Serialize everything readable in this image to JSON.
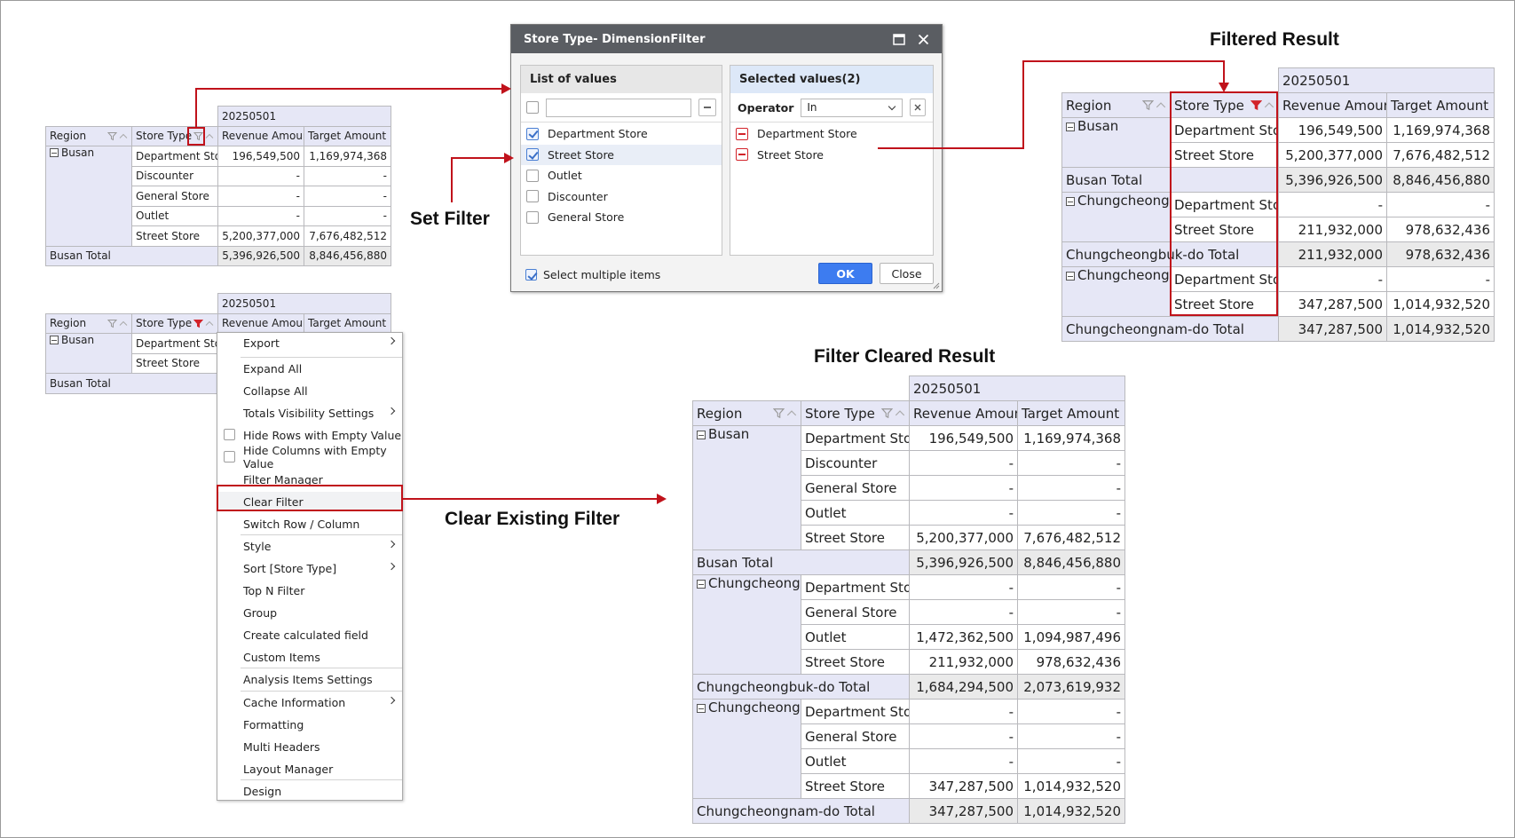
{
  "column_date": "20250501",
  "headers": {
    "region": "Region",
    "store_type": "Store Type",
    "revenue": "Revenue Amount",
    "target": "Target Amount"
  },
  "pivot_top": {
    "region": "Busan",
    "rows": [
      {
        "store": "Department Stor",
        "revenue": "196,549,500",
        "target": "1,169,974,368"
      },
      {
        "store": "Discounter",
        "revenue": "-",
        "target": "-"
      },
      {
        "store": "General Store",
        "revenue": "-",
        "target": "-"
      },
      {
        "store": "Outlet",
        "revenue": "-",
        "target": "-"
      },
      {
        "store": "Street Store",
        "revenue": "5,200,377,000",
        "target": "7,676,482,512"
      }
    ],
    "total": {
      "label": "Busan Total",
      "revenue": "5,396,926,500",
      "target": "8,846,456,880"
    }
  },
  "pivot_menu": {
    "region": "Busan",
    "rows": [
      {
        "store": "Department Stor"
      },
      {
        "store": "Street Store"
      }
    ],
    "total_label": "Busan Total"
  },
  "dialog": {
    "title": "Store Type- DimensionFilter",
    "list_header": "List of values",
    "selected_header": "Selected values(2)",
    "operator_label": "Operator",
    "operator_value": "In",
    "search_value": "",
    "list_items": [
      {
        "label": "Department Store",
        "checked": true
      },
      {
        "label": "Street Store",
        "checked": true
      },
      {
        "label": "Outlet",
        "checked": false
      },
      {
        "label": "Discounter",
        "checked": false
      },
      {
        "label": "General Store",
        "checked": false
      }
    ],
    "selected_items": [
      "Department Store",
      "Street Store"
    ],
    "multi_label": "Select multiple items",
    "ok_label": "OK",
    "close_label": "Close"
  },
  "context_menu": [
    {
      "label": "Export",
      "submenu": true
    },
    {
      "label": "Expand All"
    },
    {
      "label": "Collapse All"
    },
    {
      "label": "Totals Visibility Settings",
      "submenu": true
    },
    {
      "label": "Hide Rows with Empty Value",
      "checkbox": true
    },
    {
      "label": "Hide Columns with Empty Value",
      "checkbox": true
    },
    {
      "label": "Filter Manager"
    },
    {
      "label": "Clear Filter",
      "highlighted": true
    },
    {
      "label": "Switch Row / Column"
    },
    {
      "label": "Style",
      "submenu": true
    },
    {
      "label": "Sort [Store Type]",
      "submenu": true
    },
    {
      "label": "Top N Filter"
    },
    {
      "label": "Group"
    },
    {
      "label": "Create calculated field"
    },
    {
      "label": "Custom Items"
    },
    {
      "label": "Analysis Items Settings"
    },
    {
      "label": "Cache Information",
      "submenu": true
    },
    {
      "label": "Formatting"
    },
    {
      "label": "Multi Headers"
    },
    {
      "label": "Layout Manager"
    },
    {
      "label": "Design"
    }
  ],
  "labels": {
    "set_filter": "Set Filter",
    "clear_existing": "Clear Existing Filter",
    "filtered_result": "Filtered Result",
    "cleared_result": "Filter Cleared Result"
  },
  "filtered": {
    "groups": [
      {
        "region": "Busan",
        "rows": [
          {
            "store": "Department Stor",
            "revenue": "196,549,500",
            "target": "1,169,974,368"
          },
          {
            "store": "Street Store",
            "revenue": "5,200,377,000",
            "target": "7,676,482,512"
          }
        ],
        "total": {
          "label": "Busan Total",
          "revenue": "5,396,926,500",
          "target": "8,846,456,880"
        }
      },
      {
        "region": "Chungcheongb",
        "rows": [
          {
            "store": "Department Stor",
            "revenue": "-",
            "target": "-"
          },
          {
            "store": "Street Store",
            "revenue": "211,932,000",
            "target": "978,632,436"
          }
        ],
        "total": {
          "label": "Chungcheongbuk-do Total",
          "revenue": "211,932,000",
          "target": "978,632,436"
        }
      },
      {
        "region": "Chungcheongn",
        "rows": [
          {
            "store": "Department Stor",
            "revenue": "-",
            "target": "-"
          },
          {
            "store": "Street Store",
            "revenue": "347,287,500",
            "target": "1,014,932,520"
          }
        ],
        "total": {
          "label": "Chungcheongnam-do Total",
          "revenue": "347,287,500",
          "target": "1,014,932,520"
        }
      }
    ]
  },
  "cleared": {
    "groups": [
      {
        "region": "Busan",
        "rows": [
          {
            "store": "Department Stor",
            "revenue": "196,549,500",
            "target": "1,169,974,368"
          },
          {
            "store": "Discounter",
            "revenue": "-",
            "target": "-"
          },
          {
            "store": "General Store",
            "revenue": "-",
            "target": "-"
          },
          {
            "store": "Outlet",
            "revenue": "-",
            "target": "-"
          },
          {
            "store": "Street Store",
            "revenue": "5,200,377,000",
            "target": "7,676,482,512"
          }
        ],
        "total": {
          "label": "Busan Total",
          "revenue": "5,396,926,500",
          "target": "8,846,456,880"
        }
      },
      {
        "region": "Chungcheongb",
        "rows": [
          {
            "store": "Department Stor",
            "revenue": "-",
            "target": "-"
          },
          {
            "store": "General Store",
            "revenue": "-",
            "target": "-"
          },
          {
            "store": "Outlet",
            "revenue": "1,472,362,500",
            "target": "1,094,987,496"
          },
          {
            "store": "Street Store",
            "revenue": "211,932,000",
            "target": "978,632,436"
          }
        ],
        "total": {
          "label": "Chungcheongbuk-do Total",
          "revenue": "1,684,294,500",
          "target": "2,073,619,932"
        }
      },
      {
        "region": "Chungcheongn",
        "rows": [
          {
            "store": "Department Stor",
            "revenue": "-",
            "target": "-"
          },
          {
            "store": "General Store",
            "revenue": "-",
            "target": "-"
          },
          {
            "store": "Outlet",
            "revenue": "-",
            "target": "-"
          },
          {
            "store": "Street Store",
            "revenue": "347,287,500",
            "target": "1,014,932,520"
          }
        ],
        "total": {
          "label": "Chungcheongnam-do Total",
          "revenue": "347,287,500",
          "target": "1,014,932,520"
        }
      }
    ]
  }
}
